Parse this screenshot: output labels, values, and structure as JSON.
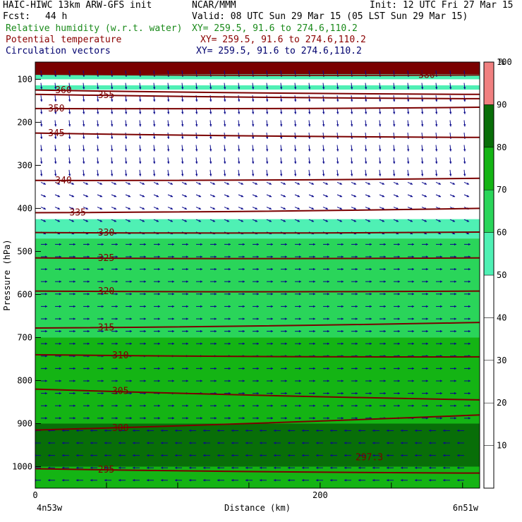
{
  "header": {
    "model_title": "HAIC-HIWC 13km ARW-GFS init",
    "center": "NCAR/MMM",
    "init": "Init: 12 UTC Fri 27 Mar 15",
    "fcst_label": "Fcst:",
    "fcst_value": "44 h",
    "valid": "Valid: 08 UTC Sun 29 Mar 15 (05 LST Sun 29 Mar 15)"
  },
  "fields": [
    {
      "name": "Relative humidity (w.r.t. water)",
      "xy": "XY= 259.5, 91.6 to 274.6,110.2",
      "color": "#1a8a1a"
    },
    {
      "name": "Potential temperature",
      "xy": "XY= 259.5, 91.6 to 274.6,110.2",
      "color": "#8b0000"
    },
    {
      "name": "Circulation vectors",
      "xy": "XY= 259.5, 91.6 to 274.6,110.2",
      "color": "#00006e"
    }
  ],
  "chart_data": {
    "type": "heatmap",
    "title": "",
    "xlabel": "Distance (km)",
    "ylabel": "Pressure (hPa)",
    "x_start_label": "4n53w",
    "x_end_label": "6n51w",
    "xlim": [
      0,
      312
    ],
    "ylim": [
      1050,
      60
    ],
    "x_ticks": [
      0,
      200
    ],
    "y_ticks": [
      100,
      200,
      300,
      400,
      500,
      600,
      700,
      800,
      900,
      1000
    ],
    "colorbar": {
      "unit": "%",
      "levels": [
        10,
        20,
        30,
        40,
        50,
        60,
        70,
        80,
        90,
        100
      ],
      "colors": [
        "#ffffff",
        "#ffffff",
        "#ffffff",
        "#ffffff",
        "#ffffff",
        "#4ff0b4",
        "#2ad55a",
        "#14b414",
        "#086e08",
        "#f08080"
      ]
    },
    "rh_layers": [
      {
        "level": 100,
        "color": "#7a0000",
        "top": 60,
        "bottom": 88
      },
      {
        "level": 60,
        "color": "#4ff0b4",
        "top": 88,
        "bottom": 100
      },
      {
        "level": 60,
        "color": "#4ff0b4",
        "top": 114,
        "bottom": 124
      },
      {
        "level": 60,
        "color": "#4ff0b4",
        "top": 425,
        "bottom": 470
      },
      {
        "level": 70,
        "color": "#2ad55a",
        "top": 470,
        "bottom": 700
      },
      {
        "level": 80,
        "color": "#14b414",
        "top": 700,
        "bottom": 900
      },
      {
        "level": 90,
        "color": "#086e08",
        "top": 900,
        "bottom": 1000
      },
      {
        "level": 80,
        "color": "#14b414",
        "top": 1000,
        "bottom": 1050
      }
    ],
    "theta_contours": [
      {
        "value": 295,
        "p_left": 1005,
        "p_right": 1015,
        "label_x": 40
      },
      {
        "value": 300,
        "p_left": 915,
        "p_right": 880,
        "label_x": 50
      },
      {
        "value": 305,
        "p_left": 820,
        "p_right": 845,
        "label_x": 50
      },
      {
        "value": 310,
        "p_left": 740,
        "p_right": 745,
        "label_x": 50
      },
      {
        "value": 315,
        "p_left": 678,
        "p_right": 665,
        "label_x": 40
      },
      {
        "value": 320,
        "p_left": 592,
        "p_right": 592,
        "label_x": 40
      },
      {
        "value": 325,
        "p_left": 515,
        "p_right": 515,
        "label_x": 40
      },
      {
        "value": 330,
        "p_left": 456,
        "p_right": 455,
        "label_x": 40
      },
      {
        "value": 335,
        "p_left": 410,
        "p_right": 400,
        "label_x": 20
      },
      {
        "value": 340,
        "p_left": 335,
        "p_right": 330,
        "label_x": 10
      },
      {
        "value": 345,
        "p_left": 225,
        "p_right": 235,
        "label_x": 5
      },
      {
        "value": 350,
        "p_left": 168,
        "p_right": 165,
        "label_x": 5
      },
      {
        "value": 355,
        "p_left": 135,
        "p_right": 145,
        "label_x": 40
      },
      {
        "value": 360,
        "p_left": 125,
        "p_right": 135,
        "label_x": 10
      },
      {
        "value": 380,
        "p_left": 88,
        "p_right": 90,
        "label_x": 265
      }
    ],
    "low_label": "297.3"
  }
}
